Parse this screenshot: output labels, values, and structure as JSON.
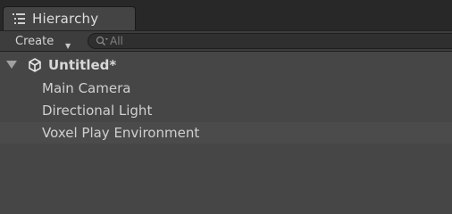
{
  "tab": {
    "label": "Hierarchy",
    "icon": "list-icon"
  },
  "toolbar": {
    "create_label": "Create",
    "search": {
      "placeholder": "All",
      "value": ""
    }
  },
  "scene": {
    "name": "Untitled*",
    "icon": "unity-logo-icon"
  },
  "items": [
    {
      "label": "Main Camera"
    },
    {
      "label": "Directional Light"
    },
    {
      "label": "Voxel Play Environment"
    }
  ],
  "colors": {
    "background": "#464646",
    "tabbar": "#282828",
    "selected_row": "#4b4b4b",
    "text": "#d0d0d0"
  }
}
